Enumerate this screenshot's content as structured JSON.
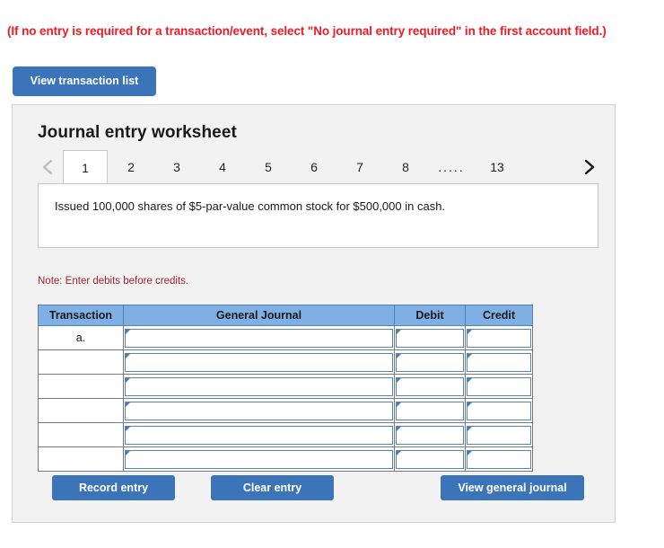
{
  "instruction": "(If no entry is required for a transaction/event, select \"No journal entry required\" in the first account field.)",
  "toolbar": {
    "view_transaction_list_label": "View transaction list"
  },
  "worksheet": {
    "title": "Journal entry worksheet",
    "tabs": [
      {
        "label": "1",
        "active": true
      },
      {
        "label": "2",
        "active": false
      },
      {
        "label": "3",
        "active": false
      },
      {
        "label": "4",
        "active": false
      },
      {
        "label": "5",
        "active": false
      },
      {
        "label": "6",
        "active": false
      },
      {
        "label": "7",
        "active": false
      },
      {
        "label": "8",
        "active": false
      },
      {
        "label": ".....",
        "active": false
      },
      {
        "label": "13",
        "active": false
      }
    ],
    "prev_icon": "chevron-left-icon",
    "next_icon": "chevron-right-icon",
    "description": "Issued 100,000 shares of $5-par-value common stock for $500,000 in cash.",
    "note": "Note: Enter debits before credits.",
    "table": {
      "headers": [
        "Transaction",
        "General Journal",
        "Debit",
        "Credit"
      ],
      "rows": [
        {
          "transaction": "a.",
          "general_journal": "",
          "debit": "",
          "credit": ""
        },
        {
          "transaction": "",
          "general_journal": "",
          "debit": "",
          "credit": ""
        },
        {
          "transaction": "",
          "general_journal": "",
          "debit": "",
          "credit": ""
        },
        {
          "transaction": "",
          "general_journal": "",
          "debit": "",
          "credit": ""
        },
        {
          "transaction": "",
          "general_journal": "",
          "debit": "",
          "credit": ""
        },
        {
          "transaction": "",
          "general_journal": "",
          "debit": "",
          "credit": ""
        }
      ]
    },
    "actions": {
      "record_entry_label": "Record entry",
      "clear_entry_label": "Clear entry",
      "view_general_journal_label": "View general journal"
    }
  },
  "colors": {
    "instruction_red": "#ee1b24",
    "note_red": "#a52230",
    "button_blue": "#3b74b8",
    "table_header_blue": "#7fb0e5",
    "panel_gray": "#f2f2f2",
    "input_border_blue": "#5484bd"
  }
}
